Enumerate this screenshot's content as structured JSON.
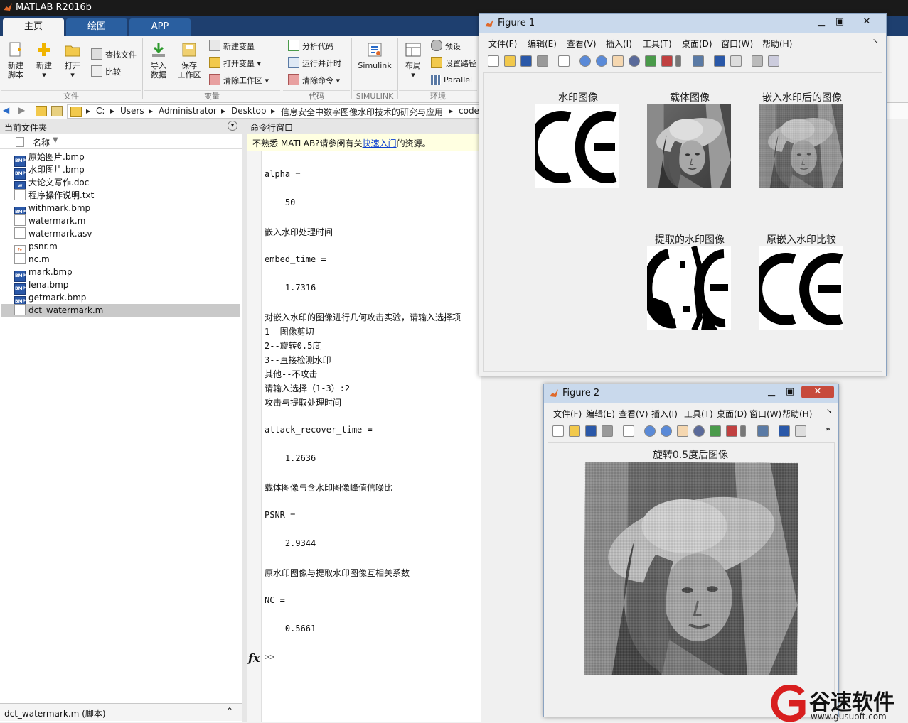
{
  "app": {
    "title": "MATLAB R2016b"
  },
  "tabs": [
    {
      "label": "主页"
    },
    {
      "label": "绘图"
    },
    {
      "label": "APP"
    }
  ],
  "ribbon": {
    "new_script": "新建\n脚本",
    "new": "新建",
    "open": "打开",
    "find_files": "查找文件",
    "compare": "比较",
    "import_data": "导入\n数据",
    "save_workspace": "保存\n工作区",
    "new_variable": "新建变量",
    "open_variable": "打开变量",
    "clear_workspace": "清除工作区",
    "analyze_code": "分析代码",
    "run_and_time": "运行并计时",
    "clear_commands": "清除命令",
    "simulink": "Simulink",
    "layout": "布局",
    "preferences": "预设",
    "set_path": "设置路径",
    "parallel": "Parallel",
    "groups": {
      "file": "文件",
      "variable": "变量",
      "code": "代码",
      "simulink": "SIMULINK",
      "environment": "环境"
    }
  },
  "address": {
    "crumbs": [
      "C:",
      "Users",
      "Administrator",
      "Desktop",
      "信息安全中数字图像水印技术的研究与应用",
      "code"
    ]
  },
  "file_panel": {
    "title": "当前文件夹",
    "column_name": "名称",
    "files": [
      {
        "name": "原始图片.bmp",
        "type": "bmp"
      },
      {
        "name": "水印图片.bmp",
        "type": "bmp"
      },
      {
        "name": "大论文写作.doc",
        "type": "doc"
      },
      {
        "name": "程序操作说明.txt",
        "type": "txt"
      },
      {
        "name": "withmark.bmp",
        "type": "bmp"
      },
      {
        "name": "watermark.m",
        "type": "m"
      },
      {
        "name": "watermark.asv",
        "type": "asv"
      },
      {
        "name": "psnr.m",
        "type": "fn"
      },
      {
        "name": "nc.m",
        "type": "m"
      },
      {
        "name": "mark.bmp",
        "type": "bmp"
      },
      {
        "name": "lena.bmp",
        "type": "bmp"
      },
      {
        "name": "getmark.bmp",
        "type": "bmp"
      },
      {
        "name": "dct_watermark.m",
        "type": "m"
      }
    ],
    "selected_index": 12,
    "footer": "dct_watermark.m  (脚本)"
  },
  "command_window": {
    "title": "命令行窗口",
    "notice_prefix": "不熟悉 MATLAB?请参阅有关",
    "notice_link": "快速入门",
    "notice_suffix": "的资源。",
    "lines": [
      "alpha =",
      "",
      "    50",
      "",
      "嵌入水印处理时间",
      "",
      "embed_time =",
      "",
      "    1.7316",
      "",
      "对嵌入水印的图像进行几何攻击实验，请输入选择项",
      "1--图像剪切",
      "2--旋转0.5度",
      "3--直接检测水印",
      "其他--不攻击",
      "请输入选择（1-3）:2",
      "攻击与提取处理时间",
      "",
      "attack_recover_time =",
      "",
      "    1.2636",
      "",
      "载体图像与含水印图像峰值信噪比",
      "",
      "PSNR =",
      "",
      "    2.9344",
      "",
      "原水印图像与提取水印图像互相关系数",
      "",
      "NC =",
      "",
      "    0.5661",
      "",
      ">>"
    ],
    "fx": "fx"
  },
  "figure1": {
    "title": "Figure 1",
    "menu": [
      "文件(F)",
      "编辑(E)",
      "查看(V)",
      "插入(I)",
      "工具(T)",
      "桌面(D)",
      "窗口(W)",
      "帮助(H)"
    ],
    "plots": [
      {
        "label": "水印图像",
        "image": "watermark CE logo"
      },
      {
        "label": "载体图像",
        "image": "lena"
      },
      {
        "label": "嵌入水印后的图像",
        "image": "lena with watermark"
      },
      {
        "label": "提取的水印图像",
        "image": "extracted watermark"
      },
      {
        "label": "原嵌入水印比较",
        "image": "original watermark"
      }
    ]
  },
  "figure2": {
    "title": "Figure 2",
    "menu": [
      "文件(F)",
      "编辑(E)",
      "查看(V)",
      "插入(I)",
      "工具(T)",
      "桌面(D)",
      "窗口(W)",
      "帮助(H)"
    ],
    "plot_label": "旋转0.5度后图像"
  },
  "watermark_brand": {
    "name": "谷速软件",
    "url": "www.gusuoft.com"
  }
}
